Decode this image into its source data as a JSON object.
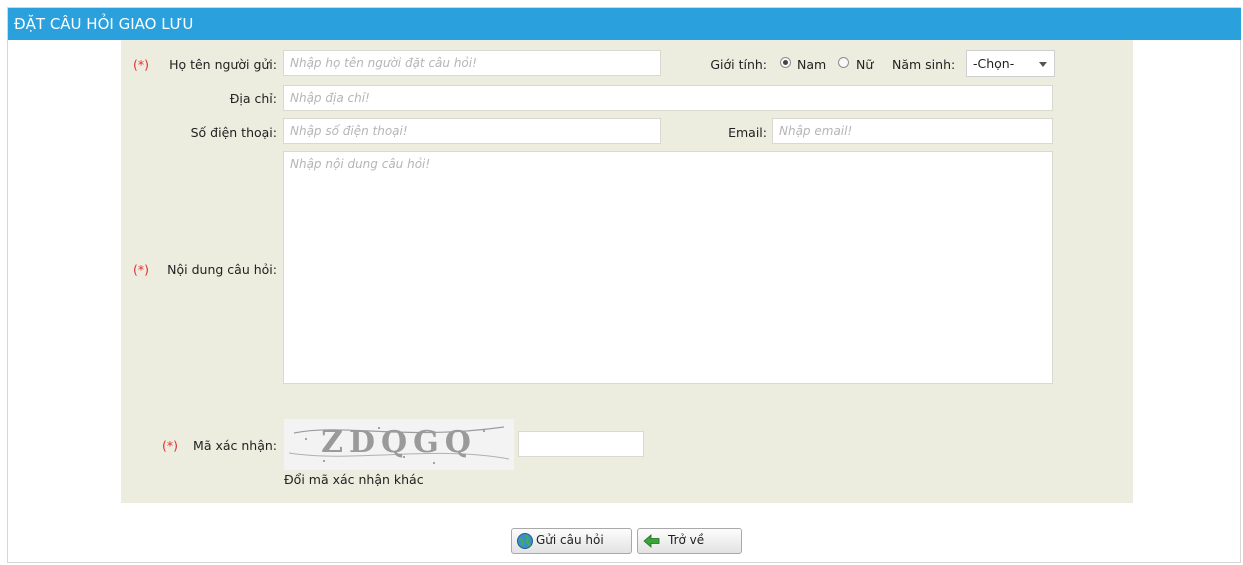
{
  "header": {
    "title": "ĐẶT CÂU HỎI GIAO LƯU"
  },
  "required_mark": "(*)",
  "form": {
    "name_label": "Họ tên người gửi:",
    "name_placeholder": "Nhập họ tên người đặt câu hỏi!",
    "gender_label": "Giới tính:",
    "gender_options": [
      "Nam",
      "Nữ"
    ],
    "gender_selected": "Nam",
    "birth_year_label": "Năm sinh:",
    "birth_year_value": "-Chọn-",
    "address_label": "Địa chỉ:",
    "address_placeholder": "Nhập địa chỉ!",
    "phone_label": "Số điện thoại:",
    "phone_placeholder": "Nhập số điện thoại!",
    "email_label": "Email:",
    "email_placeholder": "Nhập email!",
    "question_label": "Nội dung câu hỏi:",
    "question_placeholder": "Nhập nội dung câu hỏi!",
    "captcha_label": "Mã xác nhận:",
    "captcha_image_text": "ZDQGQ",
    "captcha_input_value": "",
    "captcha_refresh_link": "Đổi mã xác nhận khác"
  },
  "buttons": {
    "submit_label": "Gửi câu hỏi",
    "back_label": "Trở về"
  },
  "colors": {
    "header_bg": "#2aa0dd",
    "panel_bg": "#ececdf",
    "required": "#e03030"
  }
}
